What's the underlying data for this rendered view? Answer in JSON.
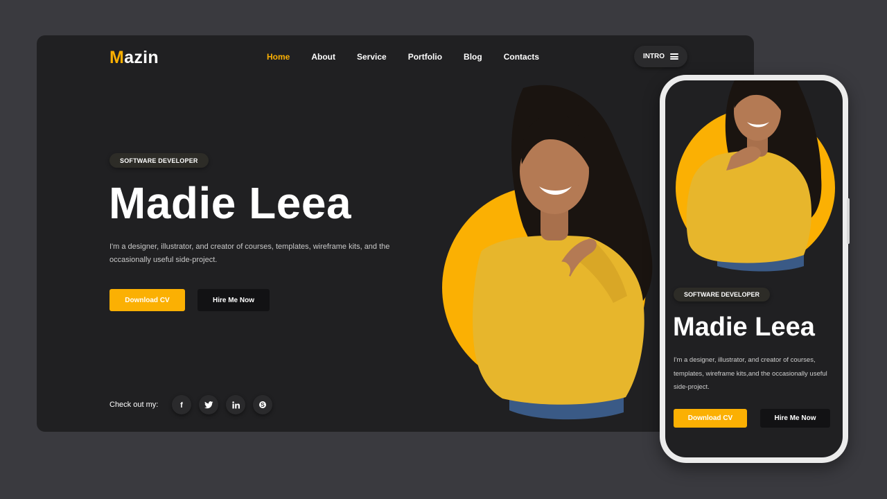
{
  "theme": {
    "accent": "#fbb003",
    "background": "#202022",
    "canvas": "#3a3a3f"
  },
  "header": {
    "logo_initial": "M",
    "logo_rest": "azin",
    "nav": [
      {
        "label": "Home",
        "active": true
      },
      {
        "label": "About",
        "active": false
      },
      {
        "label": "Service",
        "active": false
      },
      {
        "label": "Portfolio",
        "active": false
      },
      {
        "label": "Blog",
        "active": false
      },
      {
        "label": "Contacts",
        "active": false
      }
    ],
    "intro_label": "INTRO",
    "intro_icon": "hamburger-menu-icon"
  },
  "hero": {
    "badge": "SOFTWARE DEVELOPER",
    "name": "Madie Leea",
    "description": "I'm a designer, illustrator, and creator of courses, templates, wireframe kits, and the occasionally useful side-project.",
    "download_label": "Download CV",
    "hire_label": "Hire Me Now",
    "portrait": "woman-in-yellow-sweater-pointing-photo"
  },
  "social": {
    "label": "Check out my:",
    "icons": [
      "facebook-icon",
      "twitter-icon",
      "linkedin-icon",
      "skype-icon"
    ]
  },
  "mobile": {
    "badge": "SOFTWARE DEVELOPER",
    "name": "Madie Leea",
    "description": "I'm a designer, illustrator, and creator of courses, templates, wireframe kits,and the occasionally useful side-project.",
    "download_label": "Download CV",
    "hire_label": "Hire Me Now"
  }
}
